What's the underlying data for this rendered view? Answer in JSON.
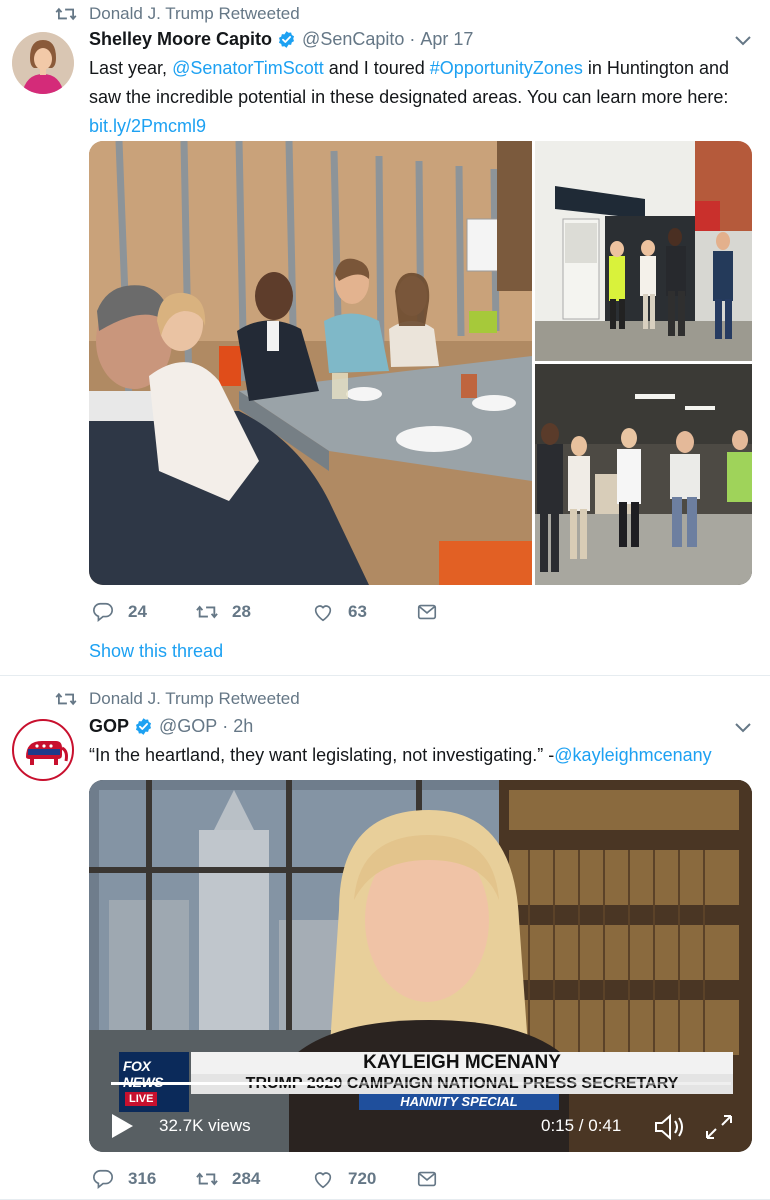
{
  "tweets": [
    {
      "retweeted_by": "Donald J. Trump Retweeted",
      "author_name": "Shelley Moore Capito",
      "handle": "@SenCapito",
      "separator": "·",
      "time": "Apr 17",
      "text": {
        "part1": "Last year, ",
        "mention": "@SenatorTimScott",
        "part2": " and I toured ",
        "hashtag": "#OpportunityZones",
        "part3": " in Huntington and saw the incredible potential in these designated areas. You can learn more here: ",
        "url": "bit.ly/2Pmcml9"
      },
      "actions": {
        "replies": "24",
        "retweets": "28",
        "likes": "63"
      },
      "show_thread": "Show this thread"
    },
    {
      "retweeted_by": "Donald J. Trump Retweeted",
      "author_name": "GOP",
      "handle": "@GOP",
      "separator": "·",
      "time": "2h",
      "text": {
        "part1": "“In the heartland, they want legislating, not investigating.” -",
        "mention": "@kayleighmcenany"
      },
      "video": {
        "views": "32.7K views",
        "time": "0:15 / 0:41",
        "progress": 0.37,
        "chyron_name": "KAYLEIGH MCENANY",
        "chyron_title": "TRUMP 2020 CAMPAIGN NATIONAL PRESS SECRETARY",
        "chyron_show": "HANNITY SPECIAL",
        "network": "FOX NEWS",
        "network_badge": "LIVE"
      },
      "actions": {
        "replies": "316",
        "retweets": "284",
        "likes": "720"
      }
    }
  ],
  "colors": {
    "accent": "#1da1f2",
    "secondary_text": "#657786",
    "border": "#e6ecf0",
    "gop_red": "#c8102e"
  },
  "icons": [
    "retweet-icon",
    "verified-badge-icon",
    "chevron-down-icon",
    "reply-icon",
    "like-icon",
    "share-icon",
    "play-icon",
    "volume-icon",
    "fullscreen-icon"
  ]
}
